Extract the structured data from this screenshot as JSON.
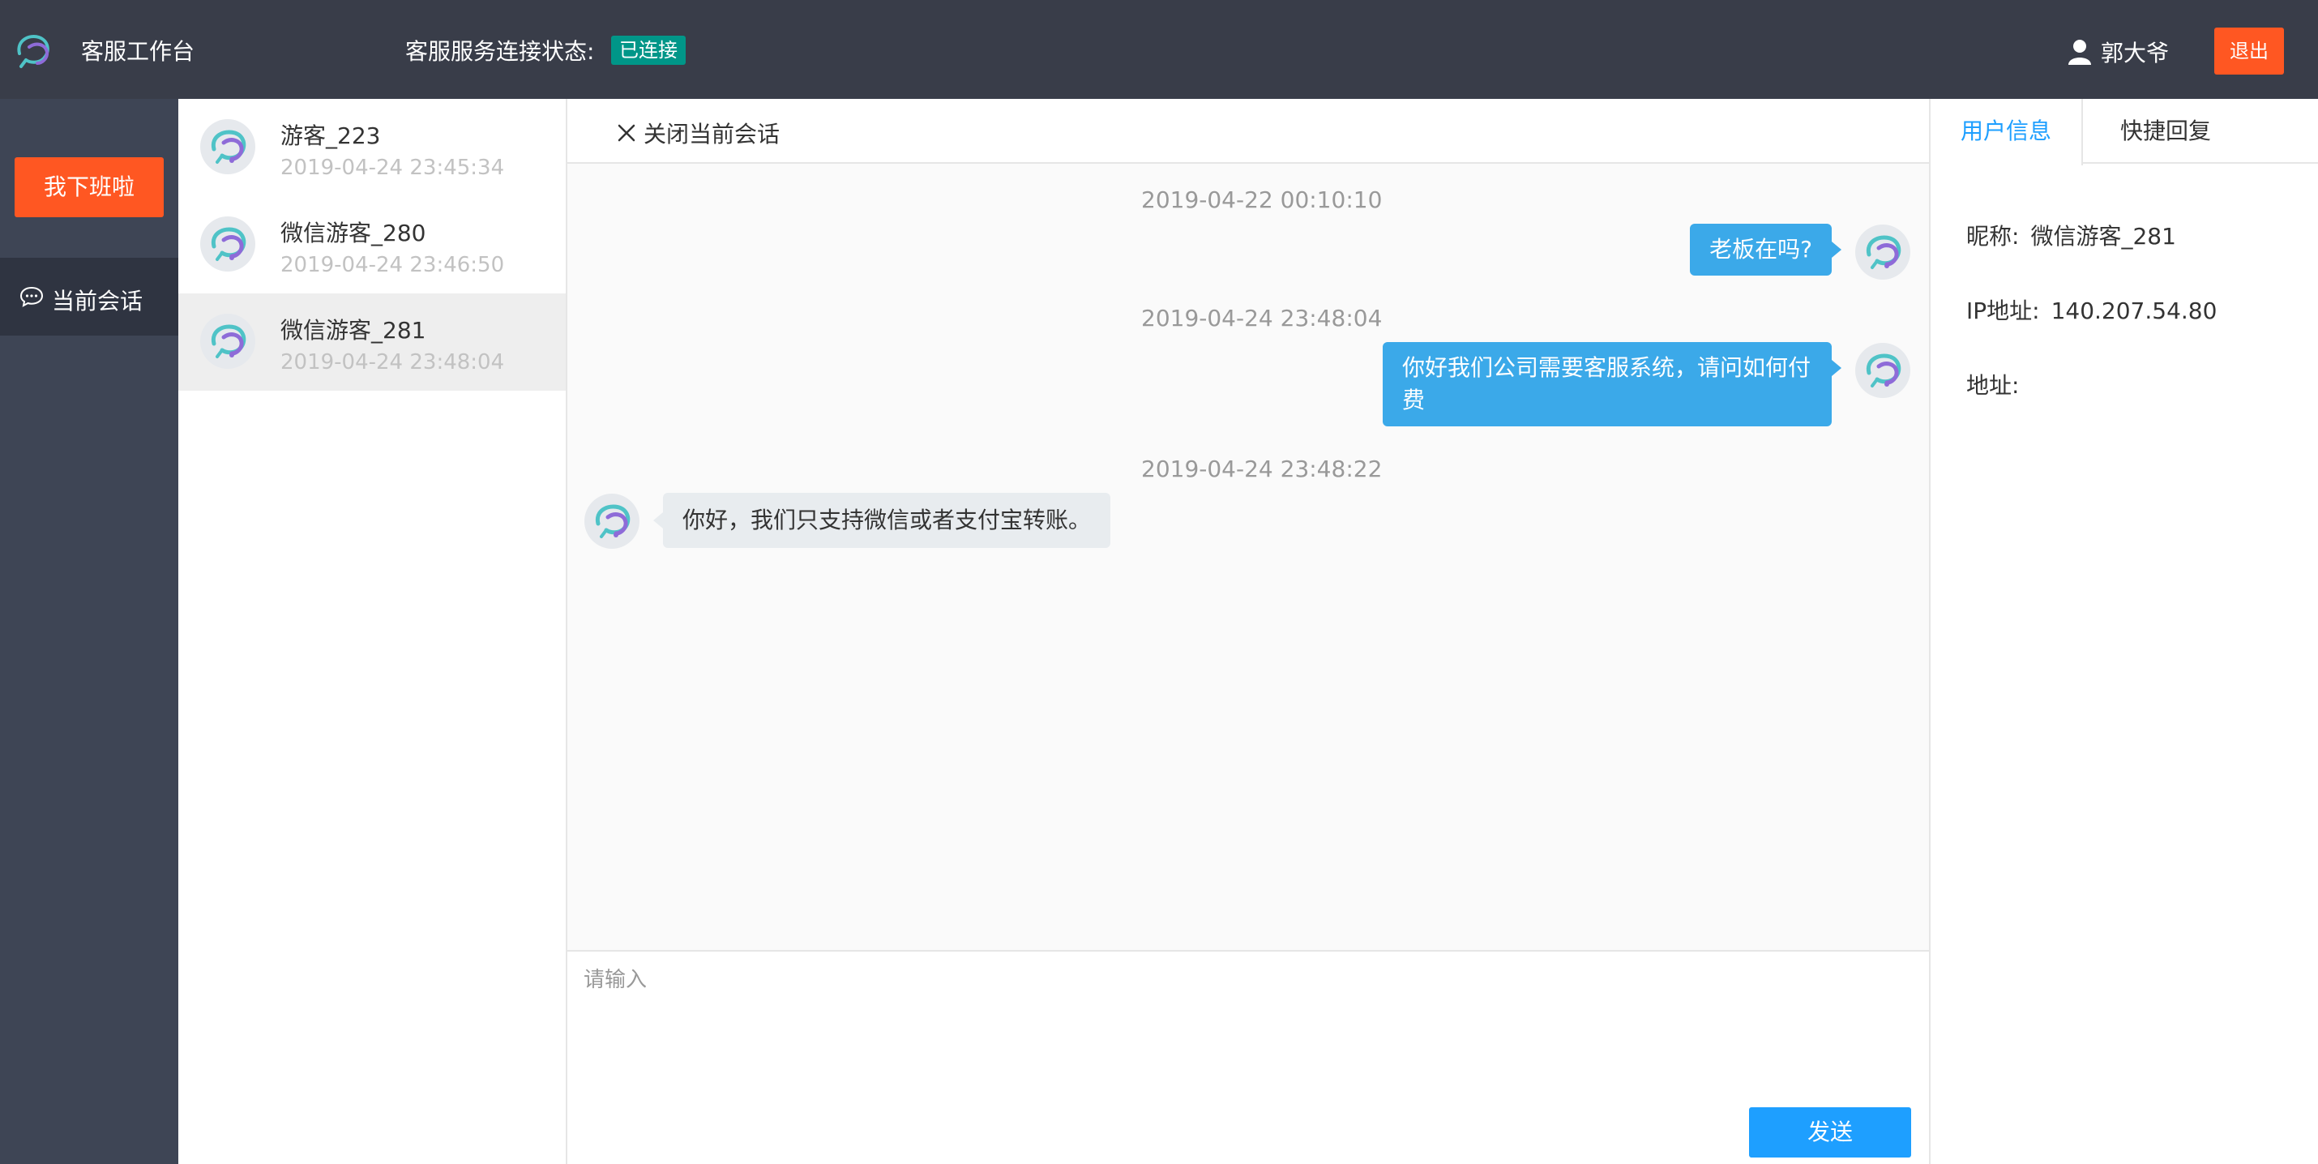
{
  "header": {
    "app_title": "客服工作台",
    "connection_label": "客服服务连接状态:",
    "connection_status": "已连接",
    "user_name": "郭大爷",
    "logout_label": "退出"
  },
  "leftnav": {
    "offwork_label": "我下班啦",
    "current_sessions_label": "当前会话"
  },
  "sessions": [
    {
      "name": "游客_223",
      "time": "2019-04-24 23:45:34"
    },
    {
      "name": "微信游客_280",
      "time": "2019-04-24 23:46:50"
    },
    {
      "name": "微信游客_281",
      "time": "2019-04-24 23:48:04"
    }
  ],
  "chat": {
    "close_label": "关闭当前会话",
    "messages": [
      {
        "time": "2019-04-22 00:10:10",
        "text": "老板在吗?",
        "side": "right"
      },
      {
        "time": "2019-04-24 23:48:04",
        "text": "你好我们公司需要客服系统，请问如何付费",
        "side": "right"
      },
      {
        "time": "2019-04-24 23:48:22",
        "text": "你好，我们只支持微信或者支付宝转账。",
        "side": "left"
      }
    ],
    "input_placeholder": "请输入",
    "send_label": "发送"
  },
  "right_panel": {
    "tabs": [
      "用户信息",
      "快捷回复"
    ],
    "nickname_label": "昵称:",
    "nickname_value": "微信游客_281",
    "ip_label": "IP地址:",
    "ip_value": "140.207.54.80",
    "address_label": "地址:",
    "address_value": ""
  },
  "colors": {
    "header_bg": "#393d49",
    "nav_bg": "#3e4555",
    "accent_orange": "#ff5722",
    "accent_blue": "#1e9fff",
    "bubble_blue": "#3ba9e9",
    "status_green": "#009688"
  },
  "icons": [
    "logo-icon",
    "user-icon",
    "chat-icon",
    "close-icon",
    "avatar-icon"
  ]
}
